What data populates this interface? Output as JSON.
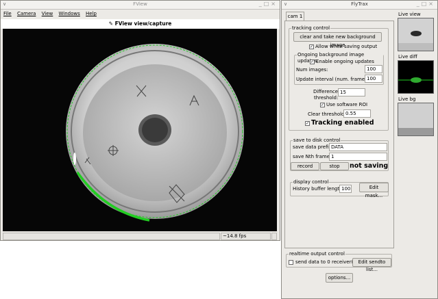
{
  "fview": {
    "title": "FView",
    "menu": [
      "File",
      "Camera",
      "View",
      "Windows",
      "Help"
    ],
    "header": "FView view/capture",
    "fps": "~14.8 fps"
  },
  "flytrax": {
    "title": "FlyTrax",
    "tab": "cam 1",
    "tracking": {
      "legend": "tracking control",
      "clear_bg_button": "clear and take new background image",
      "allow_when_saving": "Allow when saving output",
      "ongoing": {
        "legend": "Ongoing background image updates",
        "enable_label": "Enable ongoing updates",
        "num_images_label": "Num images:",
        "num_images_value": "100",
        "update_interval_label": "Update interval (num. frames):",
        "update_interval_value": "100"
      },
      "difference_label_1": "Difference",
      "difference_label_2": "threshold:",
      "difference_value": "15",
      "use_roi_label": "Use software ROI",
      "clear_threshold_label": "Clear threshold:",
      "clear_threshold_value": "0.55",
      "tracking_enabled_label": "Tracking enabled"
    },
    "save": {
      "legend": "save to disk control",
      "prefix_label": "save data prefix:",
      "prefix_value": "DATA",
      "nth_label": "save Nth frame:",
      "nth_value": "1",
      "record_button": "record",
      "stop_button": "stop",
      "status": "not saving"
    },
    "display": {
      "legend": "display control",
      "history_label": "History buffer length:",
      "history_value": "100",
      "edit_mask_button": "Edit mask..."
    },
    "realtime": {
      "legend": "realtime output control",
      "send_label": "send data to 0 receiver(s)",
      "edit_sendto_button": "Edit sendto list..."
    },
    "options_button": "options...",
    "thumbs": {
      "live_view": "Live view",
      "live_diff": "Live diff",
      "live_bg": "Live bg"
    }
  },
  "colors": {
    "window_bg": "#eceae6",
    "track_green": "#22cc22",
    "dish_light": "#d8d8d8",
    "dish_dark": "#3c3c3c"
  }
}
